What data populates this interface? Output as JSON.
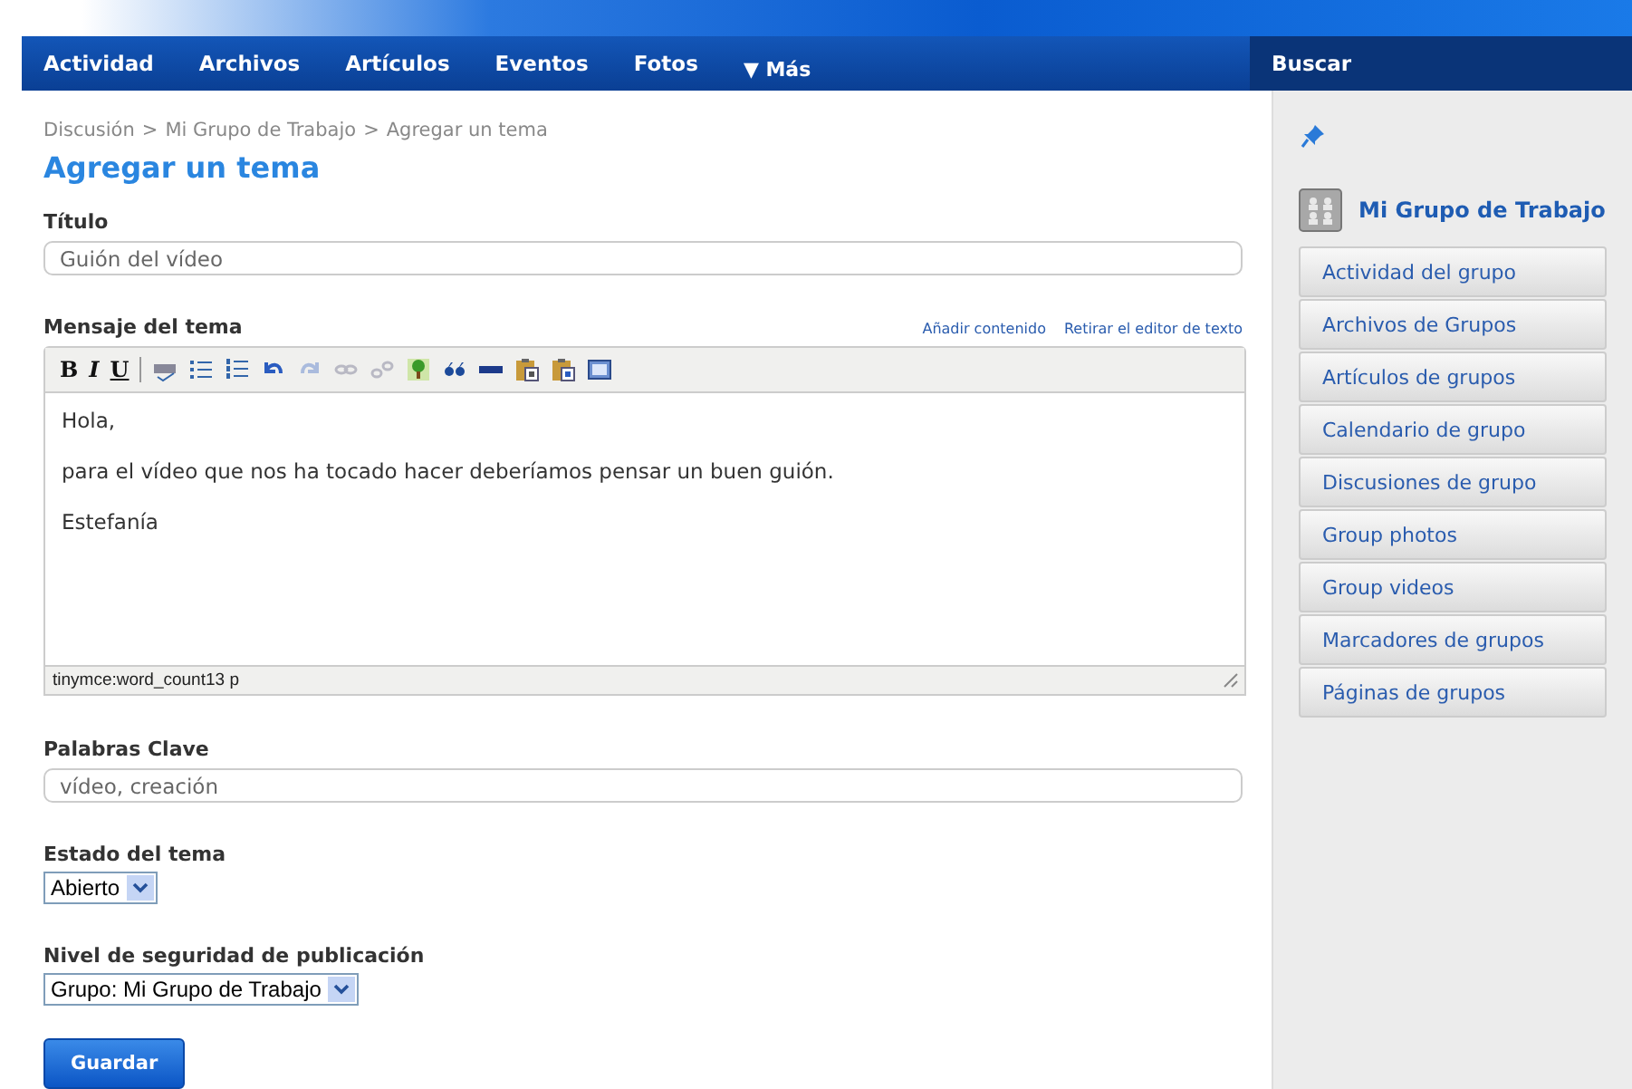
{
  "nav": {
    "items": [
      {
        "label": "Actividad",
        "kind": "link"
      },
      {
        "label": "Archivos",
        "kind": "link"
      },
      {
        "label": "Artículos",
        "kind": "link"
      },
      {
        "label": "Eventos",
        "kind": "link"
      },
      {
        "label": "Fotos",
        "kind": "link"
      },
      {
        "label": "▼ Más",
        "kind": "menu"
      }
    ],
    "search_label": "Buscar"
  },
  "breadcrumb": [
    "Discusión",
    "Mi Grupo de Trabajo",
    "Agregar un tema"
  ],
  "breadcrumb_separator": ">",
  "page_title": "Agregar un tema",
  "title_field": {
    "label": "Título",
    "value": "Guión del vídeo"
  },
  "message": {
    "label": "Mensaje del tema",
    "links": [
      "Añadir contenido",
      "Retirar el editor de texto"
    ],
    "toolbar": [
      {
        "kind": "bold",
        "label": "B",
        "disabled": false
      },
      {
        "kind": "italic",
        "label": "I",
        "disabled": false
      },
      {
        "kind": "underline",
        "label": "U",
        "disabled": false
      },
      {
        "kind": "separator"
      },
      {
        "kind": "spellcheck",
        "disabled": false
      },
      {
        "kind": "bullets",
        "disabled": false
      },
      {
        "kind": "numbers",
        "disabled": false
      },
      {
        "kind": "undo",
        "disabled": false
      },
      {
        "kind": "redo",
        "disabled": true
      },
      {
        "kind": "link",
        "disabled": true
      },
      {
        "kind": "unlink",
        "disabled": true
      },
      {
        "kind": "image",
        "disabled": false
      },
      {
        "kind": "quote",
        "disabled": false
      },
      {
        "kind": "html",
        "disabled": false
      },
      {
        "kind": "paste-text",
        "disabled": false
      },
      {
        "kind": "paste-word",
        "disabled": false
      },
      {
        "kind": "fullscreen",
        "disabled": false
      }
    ],
    "paragraphs": [
      "Hola,",
      "para el vídeo que nos ha tocado hacer deberíamos pensar un buen guión.",
      "Estefanía"
    ],
    "status": "tinymce:word_count13 p"
  },
  "keywords_field": {
    "label": "Palabras Clave",
    "value": "vídeo, creación"
  },
  "status_field": {
    "label": "Estado del tema",
    "value": "Abierto"
  },
  "access_field": {
    "label": "Nivel de seguridad de publicación",
    "value": "Grupo: Mi Grupo de Trabajo"
  },
  "save_button": "Guardar",
  "sidebar": {
    "group_name": "Mi Grupo de Trabajo",
    "menu": [
      "Actividad del grupo",
      "Archivos de Grupos",
      "Artículos de grupos",
      "Calendario de grupo",
      "Discusiones de grupo",
      "Group photos",
      "Group videos",
      "Marcadores de grupos",
      "Páginas de grupos"
    ]
  }
}
